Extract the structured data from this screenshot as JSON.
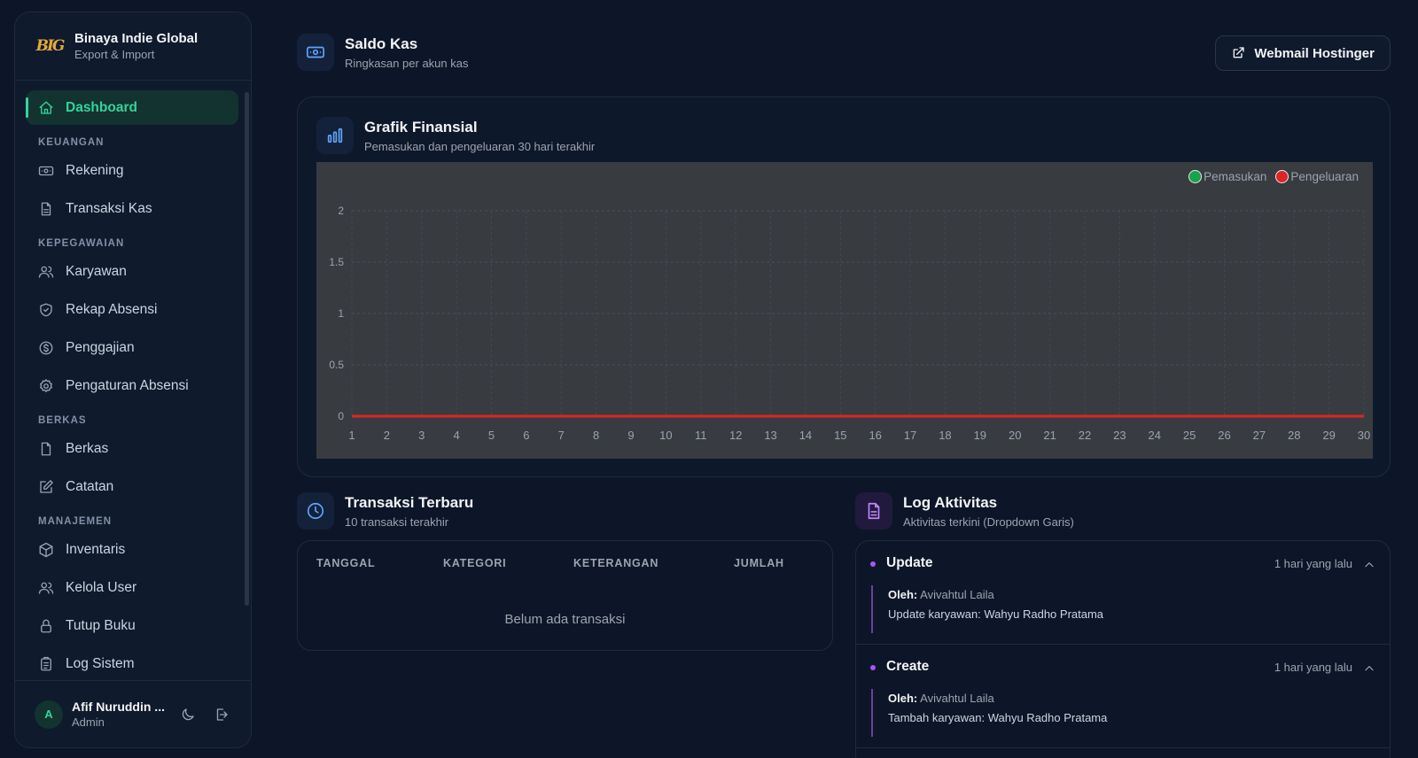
{
  "brand": {
    "title": "Binaya Indie Global",
    "subtitle": "Export & Import",
    "logo_text": "BIG"
  },
  "sidebar": {
    "dashboard": "Dashboard",
    "sections": {
      "keuangan": "KEUANGAN",
      "kepegawaian": "KEPEGAWAIAN",
      "berkas": "BERKAS",
      "manajemen": "MANAJEMEN"
    },
    "items": {
      "rekening": "Rekening",
      "transaksi_kas": "Transaksi Kas",
      "karyawan": "Karyawan",
      "rekap_absensi": "Rekap Absensi",
      "penggajian": "Penggajian",
      "pengaturan_absensi": "Pengaturan Absensi",
      "berkas": "Berkas",
      "catatan": "Catatan",
      "inventaris": "Inventaris",
      "kelola_user": "Kelola User",
      "tutup_buku": "Tutup Buku",
      "log_sistem": "Log Sistem"
    },
    "icons": [
      "home-icon",
      "banknote-icon",
      "file-text-icon",
      "users-icon",
      "shield-icon",
      "dollar-circle-icon",
      "gear-icon",
      "file-icon",
      "edit-icon",
      "box-icon",
      "users-icon",
      "lock-icon",
      "clipboard-icon"
    ]
  },
  "user": {
    "initial": "A",
    "name": "Afif Nuruddin ...",
    "role": "Admin"
  },
  "header": {
    "title": "Saldo Kas",
    "subtitle": "Ringkasan per akun kas",
    "webmail_label": "Webmail Hostinger"
  },
  "chart_card": {
    "title": "Grafik Finansial",
    "subtitle": "Pemasukan dan pengeluaran 30 hari terakhir"
  },
  "chart_data": {
    "type": "line",
    "x": [
      1,
      2,
      3,
      4,
      5,
      6,
      7,
      8,
      9,
      10,
      11,
      12,
      13,
      14,
      15,
      16,
      17,
      18,
      19,
      20,
      21,
      22,
      23,
      24,
      25,
      26,
      27,
      28,
      29,
      30
    ],
    "series": [
      {
        "name": "Pemasukan",
        "color": "#16a34a",
        "values": [
          0,
          0,
          0,
          0,
          0,
          0,
          0,
          0,
          0,
          0,
          0,
          0,
          0,
          0,
          0,
          0,
          0,
          0,
          0,
          0,
          0,
          0,
          0,
          0,
          0,
          0,
          0,
          0,
          0,
          0
        ]
      },
      {
        "name": "Pengeluaran",
        "color": "#dc2626",
        "values": [
          0,
          0,
          0,
          0,
          0,
          0,
          0,
          0,
          0,
          0,
          0,
          0,
          0,
          0,
          0,
          0,
          0,
          0,
          0,
          0,
          0,
          0,
          0,
          0,
          0,
          0,
          0,
          0,
          0,
          0
        ]
      }
    ],
    "yticks": [
      "0",
      "0.5",
      "1",
      "1.5",
      "2"
    ],
    "ylim": [
      0,
      2
    ],
    "grid": true,
    "legend": "top-right"
  },
  "transactions": {
    "title": "Transaksi Terbaru",
    "subtitle": "10 transaksi terakhir",
    "columns": [
      "TANGGAL",
      "KATEGORI",
      "KETERANGAN",
      "JUMLAH"
    ],
    "empty": "Belum ada transaksi"
  },
  "log": {
    "title": "Log Aktivitas",
    "subtitle": "Aktivitas terkini (Dropdown Garis)",
    "entries": [
      {
        "action": "Update",
        "time": "1 hari yang lalu",
        "by_label": "Oleh:",
        "by": "Avivahtul Laila",
        "desc": "Update karyawan: Wahyu Radho Pratama"
      },
      {
        "action": "Create",
        "time": "1 hari yang lalu",
        "by_label": "Oleh:",
        "by": "Avivahtul Laila",
        "desc": "Tambah karyawan: Wahyu Radho Pratama"
      }
    ]
  },
  "colors": {
    "accent": "#34d399",
    "background": "#0d1628",
    "log_accent": "#a855f7",
    "chart_bg": "#383b40"
  }
}
